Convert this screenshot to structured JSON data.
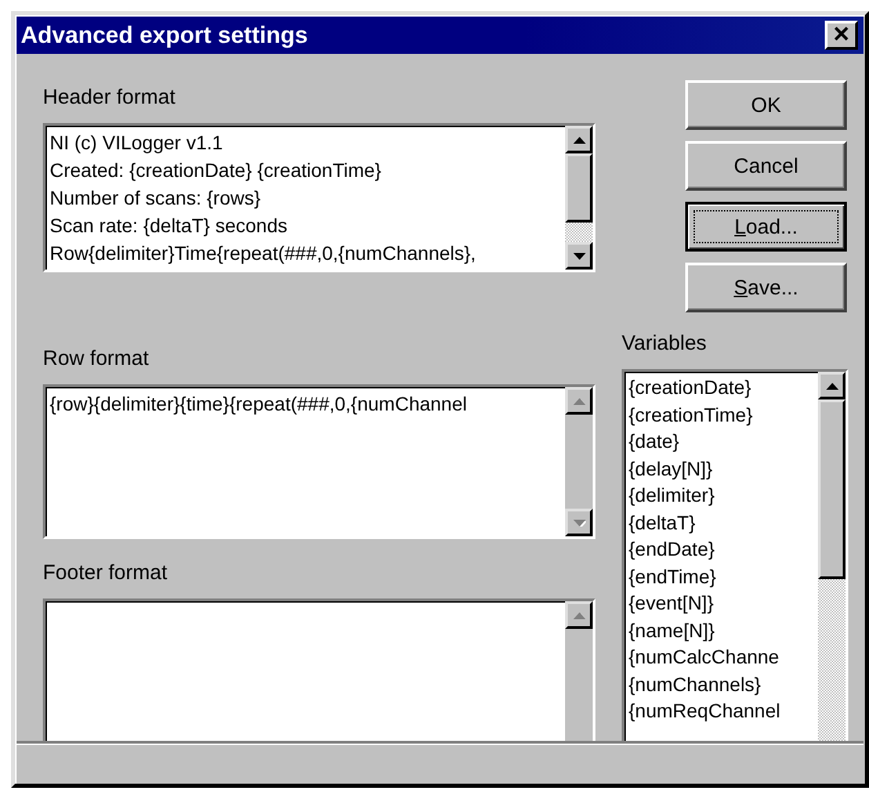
{
  "window": {
    "title": "Advanced export settings",
    "close": "×"
  },
  "header_format": {
    "label": "Header format",
    "scrollbar_enabled": true,
    "lines": [
      "NI (c) VILogger v1.1",
      "Created: {creationDate} {creationTime}",
      "Number of scans: {rows}",
      "Scan rate: {deltaT} seconds",
      "Row{delimiter}Time{repeat(###,0,{numChannels},"
    ]
  },
  "row_format": {
    "label": "Row format",
    "scrollbar_enabled": false,
    "lines": [
      "{row}{delimiter}{time}{repeat(###,0,{numChannel"
    ]
  },
  "footer_format": {
    "label": "Footer format",
    "scrollbar_enabled": false
  },
  "buttons": [
    {
      "before": "OK",
      "focused": false
    },
    {
      "before": "Cancel",
      "focused": false
    },
    {
      "key": "L",
      "after": "oad...",
      "focused": true
    },
    {
      "key": "S",
      "after": "ave...",
      "focused": false
    }
  ],
  "variables": {
    "label": "Variables",
    "scrollbar_enabled": true,
    "items": [
      "{creationDate}",
      "{creationTime}",
      "{date}",
      "{delay[N]}",
      "{delimiter}",
      "{deltaT}",
      "{endDate}",
      "{endTime}",
      "{event[N]}",
      "{name[N]}",
      "{numCalcChanne",
      "{numChannels}",
      "{numReqChannel"
    ]
  }
}
